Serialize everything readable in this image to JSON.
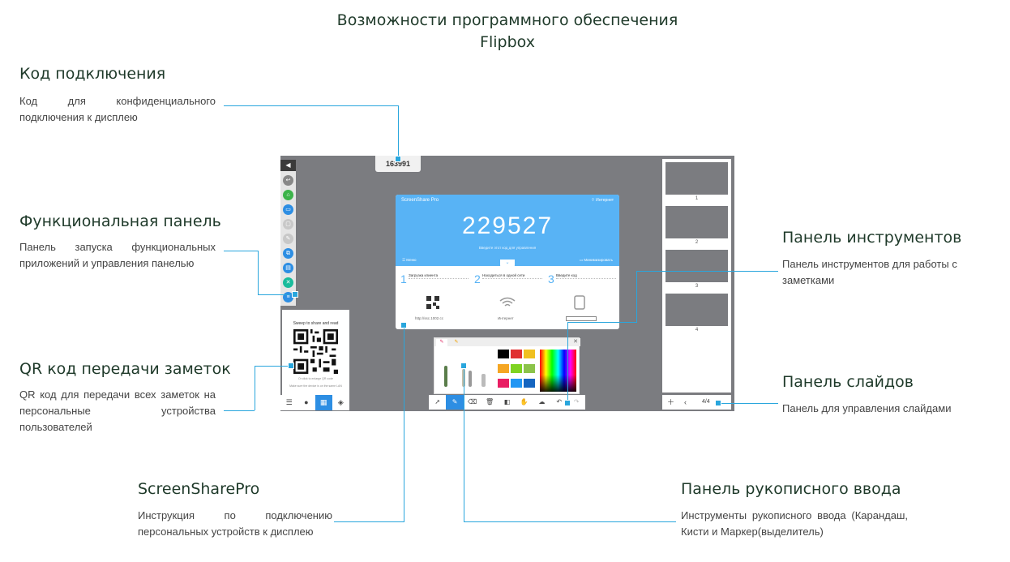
{
  "header": {
    "title_line1": "Возможности программного обеспечения",
    "title_line2": "Flipbox"
  },
  "annotations": {
    "code": {
      "title": "Код подключения",
      "desc": "Код для конфиденциального подключения к дисплею"
    },
    "func": {
      "title": "Функциональная панель",
      "desc": "Панель запуска функциональных приложений и управления панелью"
    },
    "qr": {
      "title": "QR код передачи заметок",
      "desc": "QR код для передачи всех заметок на персональные устройства пользователей"
    },
    "ssp": {
      "title": "ScreenSharePro",
      "desc": "Инструкция по подключению персональных устройств к дисплею"
    },
    "tools": {
      "title": "Панель инструментов",
      "desc": "Панель инструментов для работы с заметками"
    },
    "slides": {
      "title": "Панель слайдов",
      "desc": "Панель для управления слайдами"
    },
    "pen": {
      "title": "Панель рукописного ввода",
      "desc": "Инструменты рукописного ввода (Карандаш, Кисти и Маркер(выделитель)"
    }
  },
  "screen": {
    "connection_code": "163991",
    "qr_panel": {
      "title": "Sweep to share and read",
      "sub1": "Or click to enlarge QR code",
      "sub2": "Make sure the device is on the same LAN"
    },
    "ssp": {
      "app_name": "ScreenShare Pro",
      "network": "Интернет",
      "code": "229527",
      "hint": "Введите этот код для управления",
      "menu": "Меню",
      "minimize": "Минимизировать",
      "steps": [
        {
          "num": "1",
          "title": "Загрузка клиента"
        },
        {
          "num": "2",
          "title": "Находиться в одной сети"
        },
        {
          "num": "3",
          "title": "Введите код"
        }
      ],
      "url": "http://ssc.1002.cc",
      "network_label": "Интернет"
    },
    "slides": {
      "numbers": [
        "1",
        "2",
        "3",
        "4"
      ],
      "page": "4/4"
    },
    "colors": {
      "accent": "#29a6dd",
      "screen_bg": "#7b7c80",
      "ssp_blue": "#58b3f5",
      "active": "#2d8ee3"
    },
    "swatches": [
      "#000000",
      "#e03030",
      "#f0c020",
      "#f5a623",
      "#7ed321",
      "#8bc34a",
      "#e91e63",
      "#2196f3",
      "#1565c0"
    ]
  }
}
